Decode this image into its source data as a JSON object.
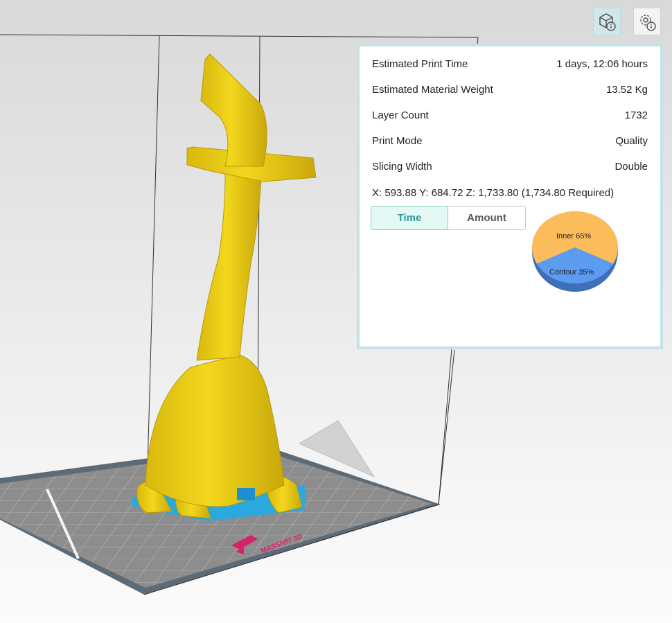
{
  "toolbar": {
    "model_info_icon": "cube-info-icon",
    "settings_info_icon": "gear-info-icon"
  },
  "info_panel": {
    "rows": [
      {
        "label": "Estimated Print Time",
        "value": "1 days, 12:06 hours"
      },
      {
        "label": "Estimated Material Weight",
        "value": "13.52 Kg"
      },
      {
        "label": "Layer Count",
        "value": "1732"
      },
      {
        "label": "Print Mode",
        "value": "Quality"
      },
      {
        "label": "Slicing Width",
        "value": "Double"
      }
    ],
    "coordinates": "X: 593.88  Y: 684.72  Z: 1,733.80 (1,734.80 Required)",
    "tabs": [
      {
        "label": "Time",
        "active": true
      },
      {
        "label": "Amount",
        "active": false
      }
    ],
    "pie": {
      "inner_label": "Inner 65%",
      "contour_label": "Contour 35%",
      "inner_percent": 65,
      "contour_percent": 35,
      "inner_color": "#fcbc5c",
      "contour_color": "#5b9cf0"
    }
  },
  "bed": {
    "logo_text": "MASSIVIT 3D",
    "logo_color": "#d4236b",
    "surface_color": "#8a8a8a",
    "border_color": "#5a6a78"
  },
  "model": {
    "color": "#e8cc1c",
    "support_color": "#2aa8e0"
  }
}
